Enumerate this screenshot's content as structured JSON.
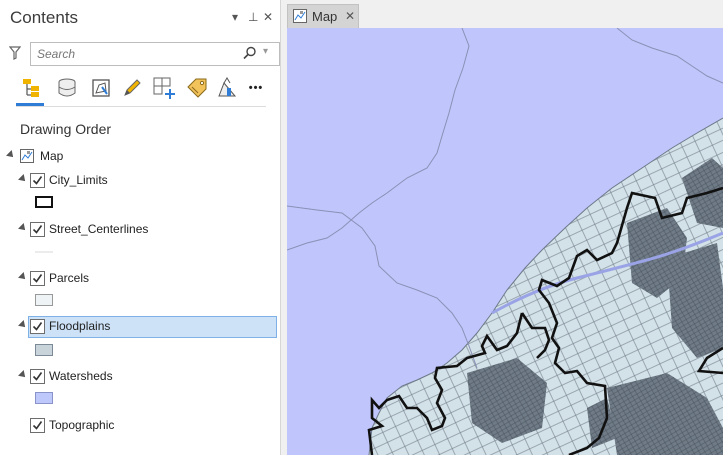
{
  "contents_pane": {
    "title": "Contents",
    "controls": {
      "menu": "▾",
      "pin": "⊥",
      "close": "✕"
    },
    "search": {
      "placeholder": "Search"
    },
    "toolbar_icons": [
      "list-by-drawing-order-icon",
      "list-by-data-source-icon",
      "list-by-selection-icon",
      "list-by-editing-icon",
      "list-by-snapping-icon",
      "list-by-labeling-icon",
      "list-by-perspective-icon",
      "more-options-icon"
    ],
    "more_label": "•••",
    "section_title": "Drawing Order",
    "map_node": {
      "label": "Map"
    },
    "layers": [
      {
        "label": "City_Limits",
        "checked": true
      },
      {
        "label": "Street_Centerlines",
        "checked": true
      },
      {
        "label": "Parcels",
        "checked": true
      },
      {
        "label": "Floodplains",
        "checked": true,
        "selected": true
      },
      {
        "label": "Watersheds",
        "checked": true
      },
      {
        "label": "Topographic",
        "checked": true
      }
    ]
  },
  "map_tab": {
    "label": "Map",
    "close": "✕"
  },
  "colors": {
    "water": "#c0c6fb",
    "land": "#d3e1e8",
    "parcel_line": "#586470",
    "city_limits": "#111111",
    "selection": "#cde2f7",
    "accent": "#2e7cd6"
  }
}
